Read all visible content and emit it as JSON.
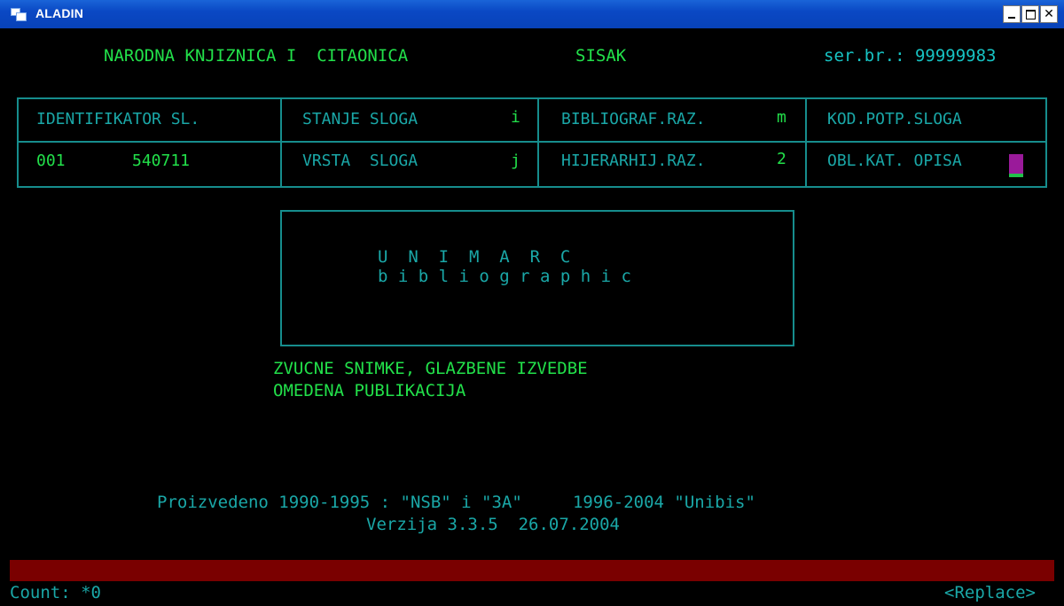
{
  "window": {
    "title": "ALADIN",
    "controls": {
      "minimize": "_",
      "maximize": "□",
      "close": "✕"
    }
  },
  "header": {
    "library": "NARODNA KNJIZNICA I  CITAONICA",
    "city": "SISAK",
    "serial": "ser.br.: 99999983"
  },
  "record": {
    "col1": {
      "label": "IDENTIFIKATOR SL.",
      "field": "001",
      "value": "540711"
    },
    "col2": {
      "label1": "STANJE SLOGA",
      "value1": "i",
      "label2": "VRSTA  SLOGA",
      "value2": "j"
    },
    "col3": {
      "label1": "BIBLIOGRAF.RAZ.",
      "value1": "m",
      "label2": "HIJERARHIJ.RAZ.",
      "value2": "2"
    },
    "col4": {
      "label1": "KOD.POTP.SLOGA",
      "label2": "OBL.KAT. OPISA"
    }
  },
  "logo": {
    "line1": "U  N  I  M  A  R  C",
    "line2": "b i b l i o g r a p h i c"
  },
  "descriptions": {
    "line1": "ZVUCNE SNIMKE, GLAZBENE IZVEDBE",
    "line2": "OMEDENA PUBLIKACIJA"
  },
  "credits": {
    "line1": "Proizvedeno 1990-1995 : \"NSB\" i \"3A\"     1996-2004 \"Unibis\"",
    "line2": "Verzija 3.3.5  26.07.2004"
  },
  "status": {
    "count": "Count: *0",
    "mode": "<Replace>"
  },
  "colors": {
    "titlebar": "#0a48c4",
    "text_green": "#22e04a",
    "text_cyan": "#1aa7a7",
    "border": "#168d8d",
    "status_bar": "#7a0000",
    "cursor": "#9a1a9a"
  }
}
